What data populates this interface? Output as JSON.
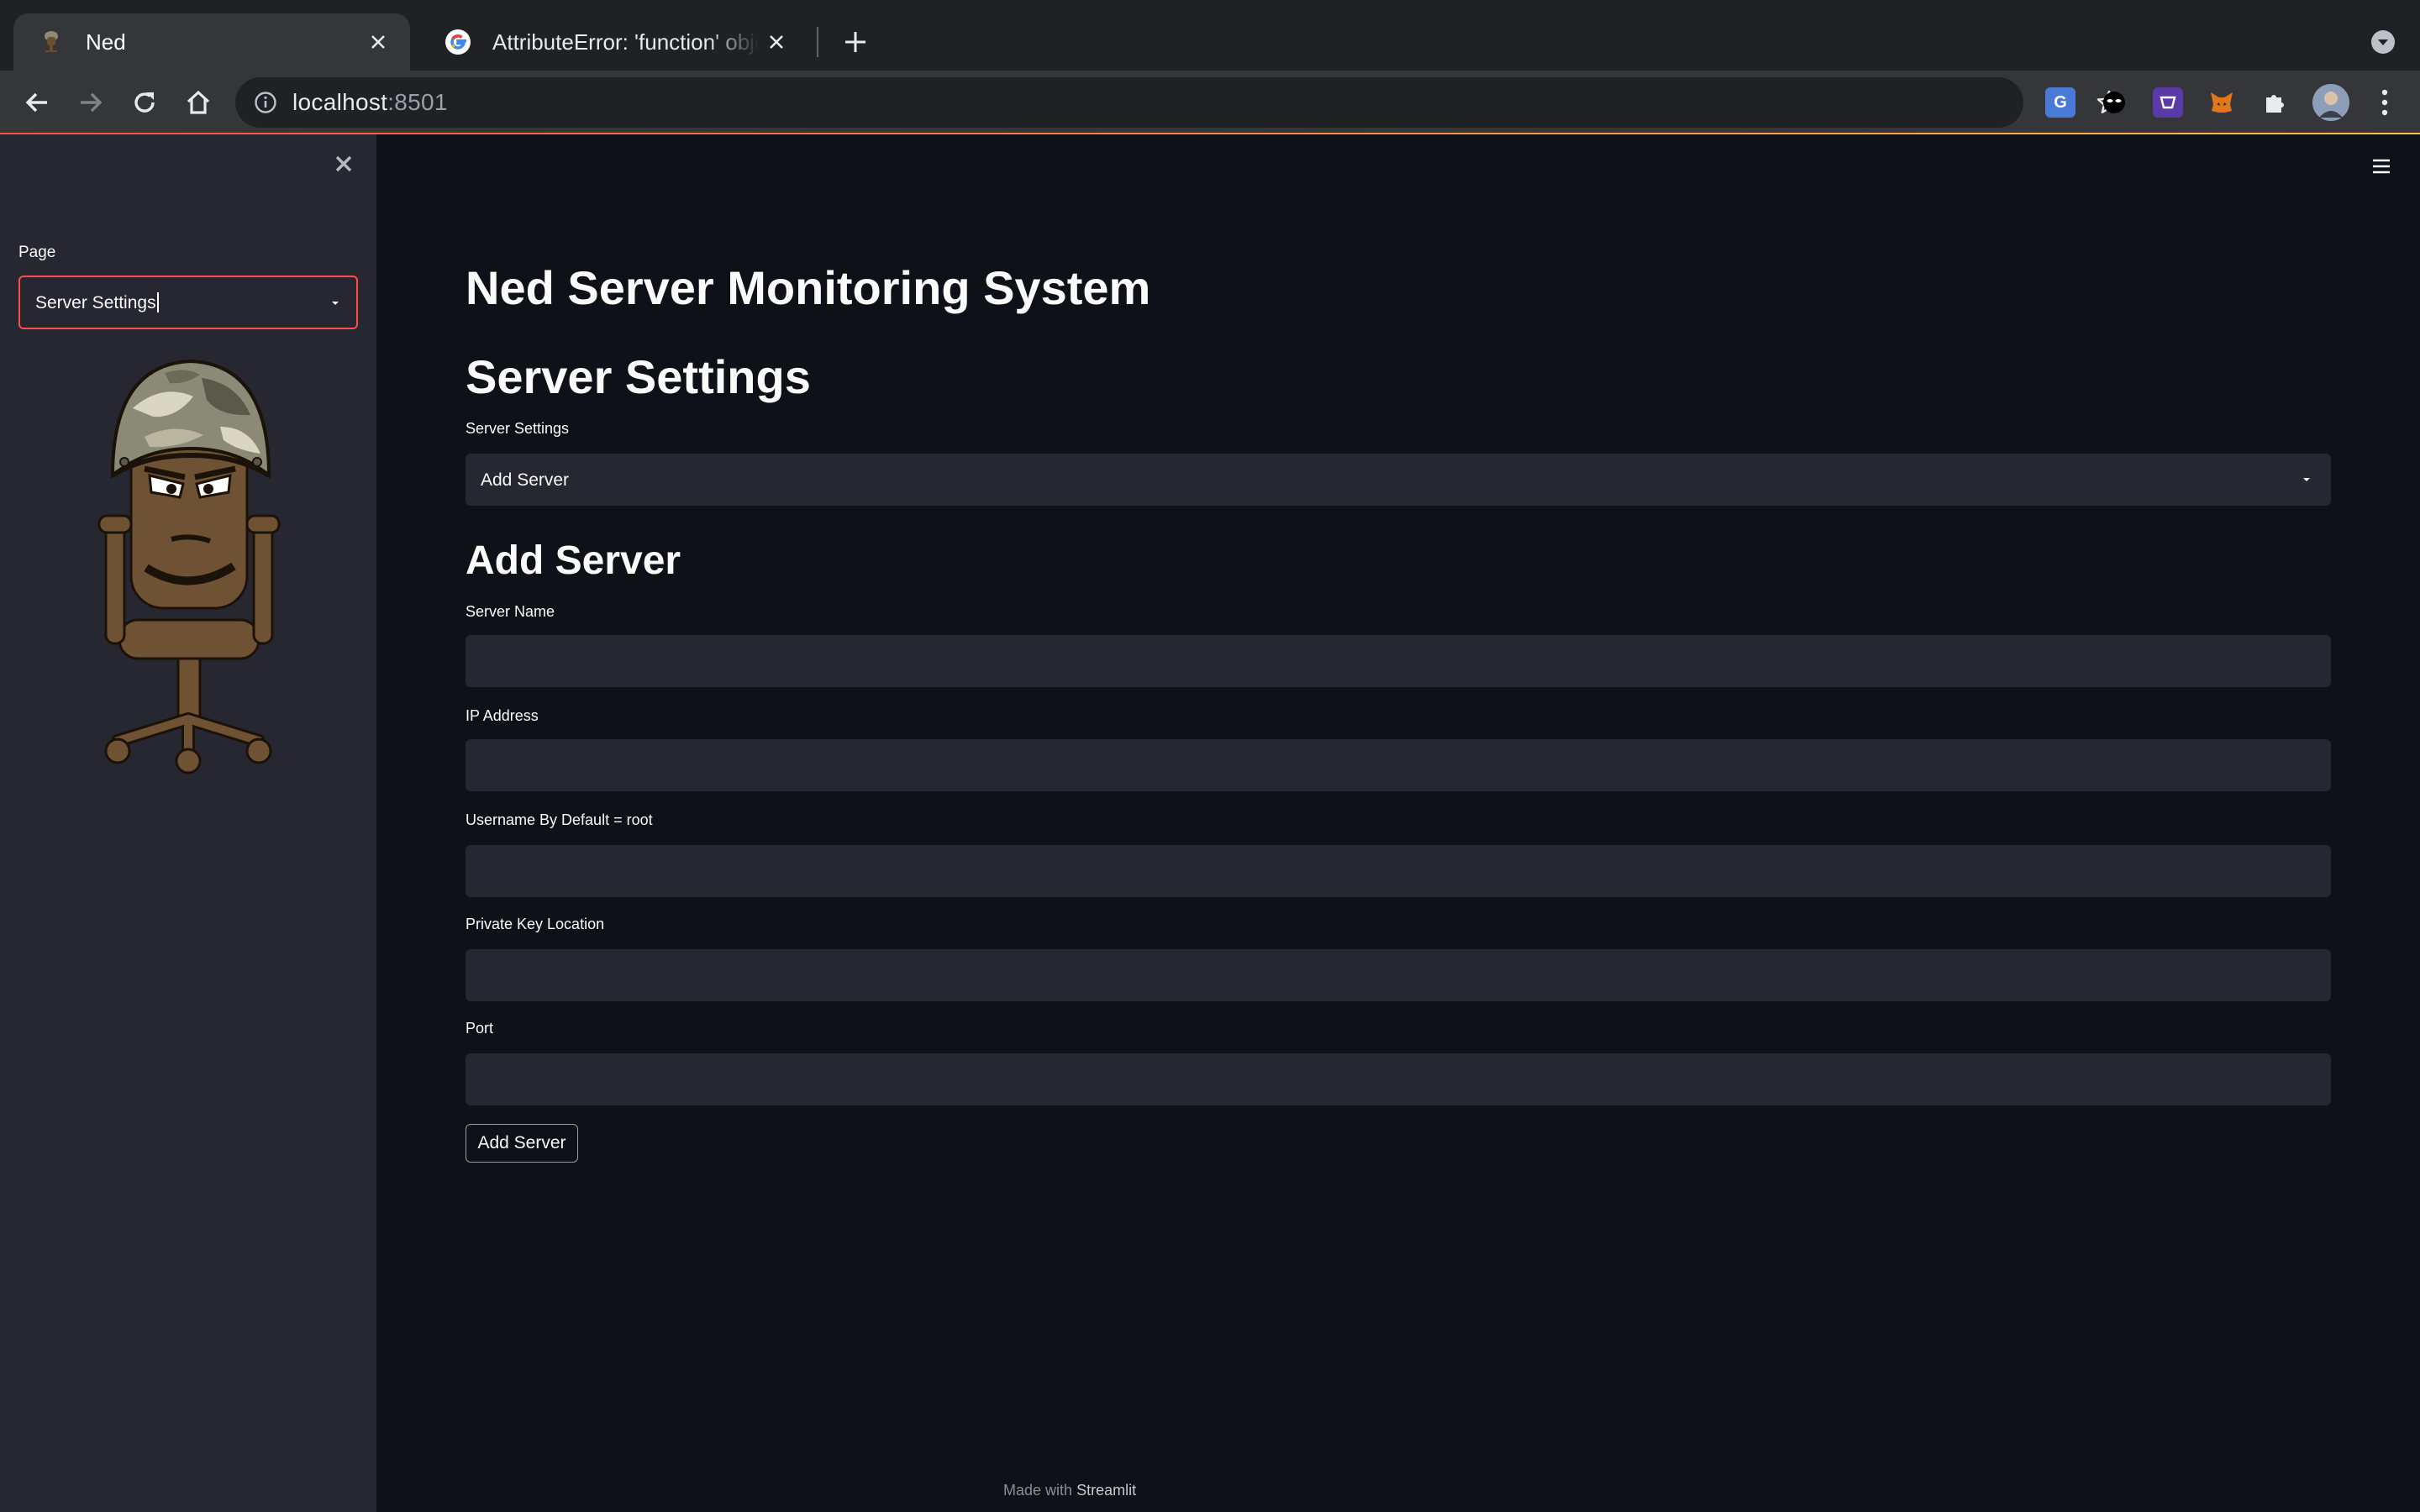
{
  "browser": {
    "tabs": [
      {
        "title": "Ned",
        "favicon": "ned-mascot-icon",
        "active": true
      },
      {
        "title": "AttributeError: 'function' object",
        "favicon": "google-icon",
        "active": false
      }
    ],
    "url_host": "localhost",
    "url_port": ":8501",
    "extensions": [
      "google-translate-icon",
      "incognito-mask-icon",
      "purple-extension-icon",
      "metamask-fox-icon",
      "puzzle-icon",
      "profile-avatar-icon"
    ]
  },
  "sidebar": {
    "page_label": "Page",
    "page_select_value": "Server Settings"
  },
  "main": {
    "app_title": "Ned Server Monitoring System",
    "section_title": "Server Settings",
    "settings_select_label": "Server Settings",
    "settings_select_value": "Add Server",
    "form_title": "Add Server",
    "fields": [
      {
        "label": "Server Name",
        "value": ""
      },
      {
        "label": "IP Address",
        "value": ""
      },
      {
        "label": "Username By Default = root",
        "value": ""
      },
      {
        "label": "Private Key Location",
        "value": ""
      },
      {
        "label": "Port",
        "value": ""
      }
    ],
    "submit_label": "Add Server"
  },
  "footer": {
    "made_with": "Made with",
    "brand": "Streamlit"
  },
  "colors": {
    "background": "#0e1117",
    "sidebar": "#262730",
    "input": "#262730",
    "accent": "#ff4b4b"
  }
}
